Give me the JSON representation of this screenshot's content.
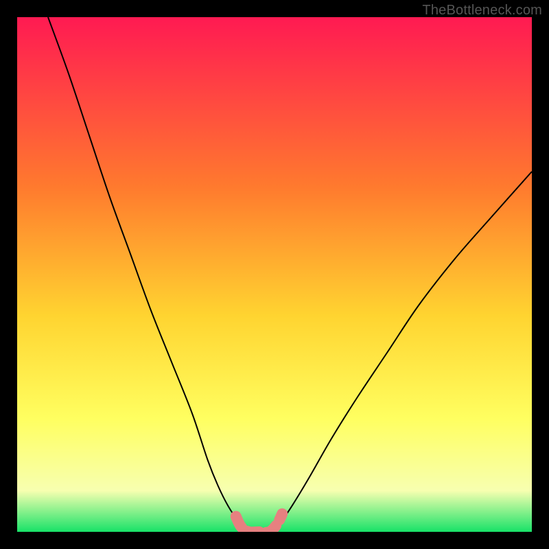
{
  "watermark": "TheBottleneck.com",
  "colors": {
    "gradient_top": "#ff1a52",
    "gradient_mid1": "#ff7a2e",
    "gradient_mid2": "#ffd430",
    "gradient_mid3": "#ffff60",
    "gradient_pale": "#f7ffb0",
    "gradient_bottom": "#18e268",
    "curve": "#000000",
    "marker": "#e68080"
  },
  "chart_data": {
    "type": "line",
    "title": "",
    "xlabel": "",
    "ylabel": "",
    "xlim": [
      0,
      100
    ],
    "ylim": [
      0,
      100
    ],
    "series": [
      {
        "name": "left-curve",
        "x": [
          6,
          10,
          14,
          18,
          22,
          26,
          30,
          34,
          37,
          39,
          41,
          43,
          44,
          45
        ],
        "y": [
          100,
          89,
          77,
          65,
          54,
          43,
          33,
          23,
          14,
          9,
          5,
          2,
          1,
          0
        ]
      },
      {
        "name": "right-curve",
        "x": [
          49,
          50,
          52,
          54,
          57,
          61,
          66,
          72,
          78,
          85,
          92,
          100
        ],
        "y": [
          0,
          1,
          3,
          6,
          11,
          18,
          26,
          35,
          44,
          53,
          61,
          70
        ]
      },
      {
        "name": "bottom-plateau",
        "x": [
          45,
          47,
          49
        ],
        "y": [
          0,
          0,
          0
        ]
      }
    ],
    "markers": [
      {
        "name": "left-marker-top",
        "x": 42.5,
        "y": 3
      },
      {
        "name": "left-marker-mid",
        "x": 43.5,
        "y": 1
      },
      {
        "name": "plateau-marker-1",
        "x": 45,
        "y": 0
      },
      {
        "name": "plateau-marker-2",
        "x": 47,
        "y": 0
      },
      {
        "name": "plateau-marker-3",
        "x": 49,
        "y": 0
      },
      {
        "name": "right-marker-mid",
        "x": 50.5,
        "y": 1.5
      },
      {
        "name": "right-marker-top",
        "x": 51.5,
        "y": 3.5
      }
    ]
  }
}
